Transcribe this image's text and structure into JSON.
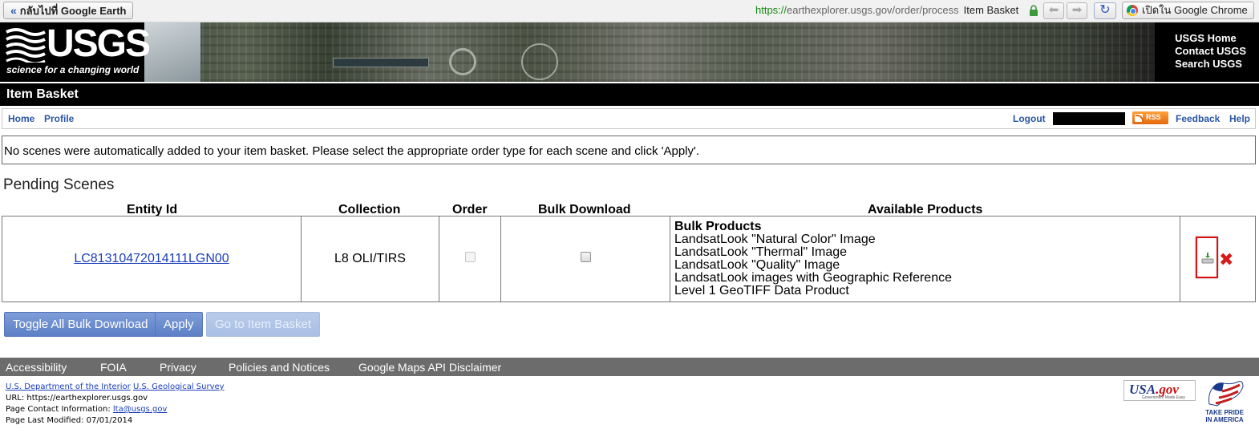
{
  "browser": {
    "back_label": "กลับไปที่ Google Earth",
    "url_protocol": "https://",
    "url_rest": "earthexplorer.usgs.gov/order/process",
    "page_title": "Item Basket",
    "open_in_chrome_label": "เปิดใน Google Chrome"
  },
  "header": {
    "logo_text": "USGS",
    "tagline": "science for a changing world",
    "links": [
      "USGS Home",
      "Contact USGS",
      "Search USGS"
    ],
    "title": "Item Basket"
  },
  "nav": {
    "home": "Home",
    "profile": "Profile",
    "logout": "Logout",
    "rss": "RSS",
    "feedback": "Feedback",
    "help": "Help"
  },
  "message": "No scenes were automatically added to your item basket. Please select the appropriate order type for each scene and click 'Apply'.",
  "pending": {
    "title": "Pending Scenes",
    "columns": [
      "Entity Id",
      "Collection",
      "Order",
      "Bulk Download",
      "Available Products"
    ],
    "rows": [
      {
        "entity_id": "LC81310472014111LGN00",
        "collection": "L8 OLI/TIRS",
        "products_heading": "Bulk Products",
        "products": [
          "LandsatLook \"Natural Color\" Image",
          "LandsatLook \"Thermal\" Image",
          "LandsatLook \"Quality\" Image",
          "LandsatLook images with Geographic Reference",
          "Level 1 GeoTIFF Data Product"
        ]
      }
    ]
  },
  "buttons": {
    "toggle_bulk": "Toggle All Bulk Download",
    "apply": "Apply",
    "go_basket": "Go to Item Basket"
  },
  "footer": {
    "links": [
      "Accessibility",
      "FOIA",
      "Privacy",
      "Policies and Notices",
      "Google Maps API Disclaimer"
    ],
    "doi": "U.S. Department of the Interior",
    "usgs": "U.S. Geological Survey",
    "url_line": "URL: https://earthexplorer.usgs.gov",
    "contact_prefix": "Page Contact Information: ",
    "contact_email": "lta@usgs.gov",
    "modified": "Page Last Modified: 07/01/2014",
    "usagov_usa": "USA",
    "usagov_gov": ".gov",
    "usagov_slogan": "Government Made Easy",
    "pride_line1": "TAKE PRIDE",
    "pride_line2": "IN AMERICA"
  },
  "colors": {
    "link": "#2a56a3",
    "button": "#5c7fc6",
    "footer_bar": "#6c6c6c",
    "delete": "#d81a1a"
  }
}
